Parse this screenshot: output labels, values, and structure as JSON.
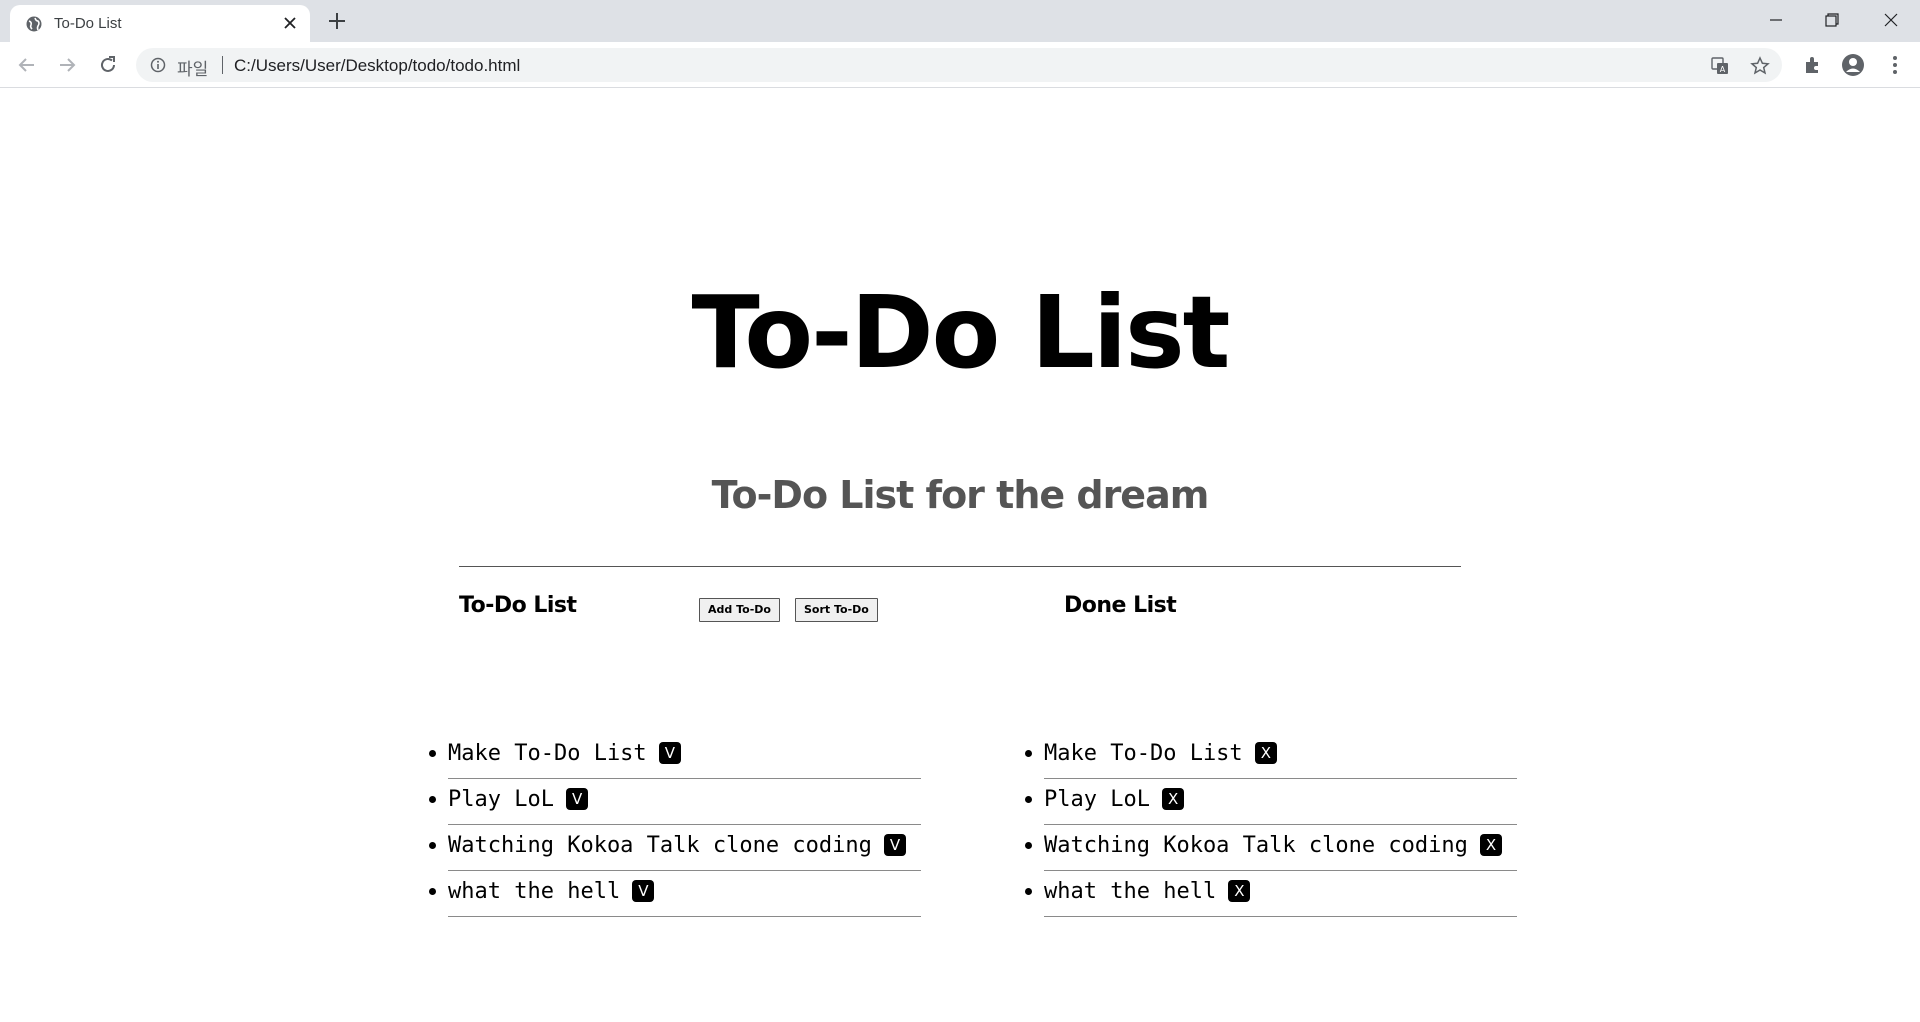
{
  "browser": {
    "tab_title": "To-Do List",
    "scheme_label": "파일",
    "url": "C:/Users/User/Desktop/todo/todo.html"
  },
  "page": {
    "title": "To-Do List",
    "subtitle": "To-Do List for the dream",
    "todo": {
      "heading": "To-Do List",
      "add_button": "Add To-Do",
      "sort_button": "Sort To-Do",
      "items": [
        {
          "text": "Make To-Do List",
          "action": "V"
        },
        {
          "text": "Play LoL",
          "action": "V"
        },
        {
          "text": "Watching Kokoa Talk clone coding",
          "action": "V"
        },
        {
          "text": "what the hell",
          "action": "V"
        }
      ]
    },
    "done": {
      "heading": "Done List",
      "items": [
        {
          "text": "Make To-Do List",
          "action": "X"
        },
        {
          "text": "Play LoL",
          "action": "X"
        },
        {
          "text": "Watching Kokoa Talk clone coding",
          "action": "X"
        },
        {
          "text": "what the hell",
          "action": "X"
        }
      ]
    }
  }
}
